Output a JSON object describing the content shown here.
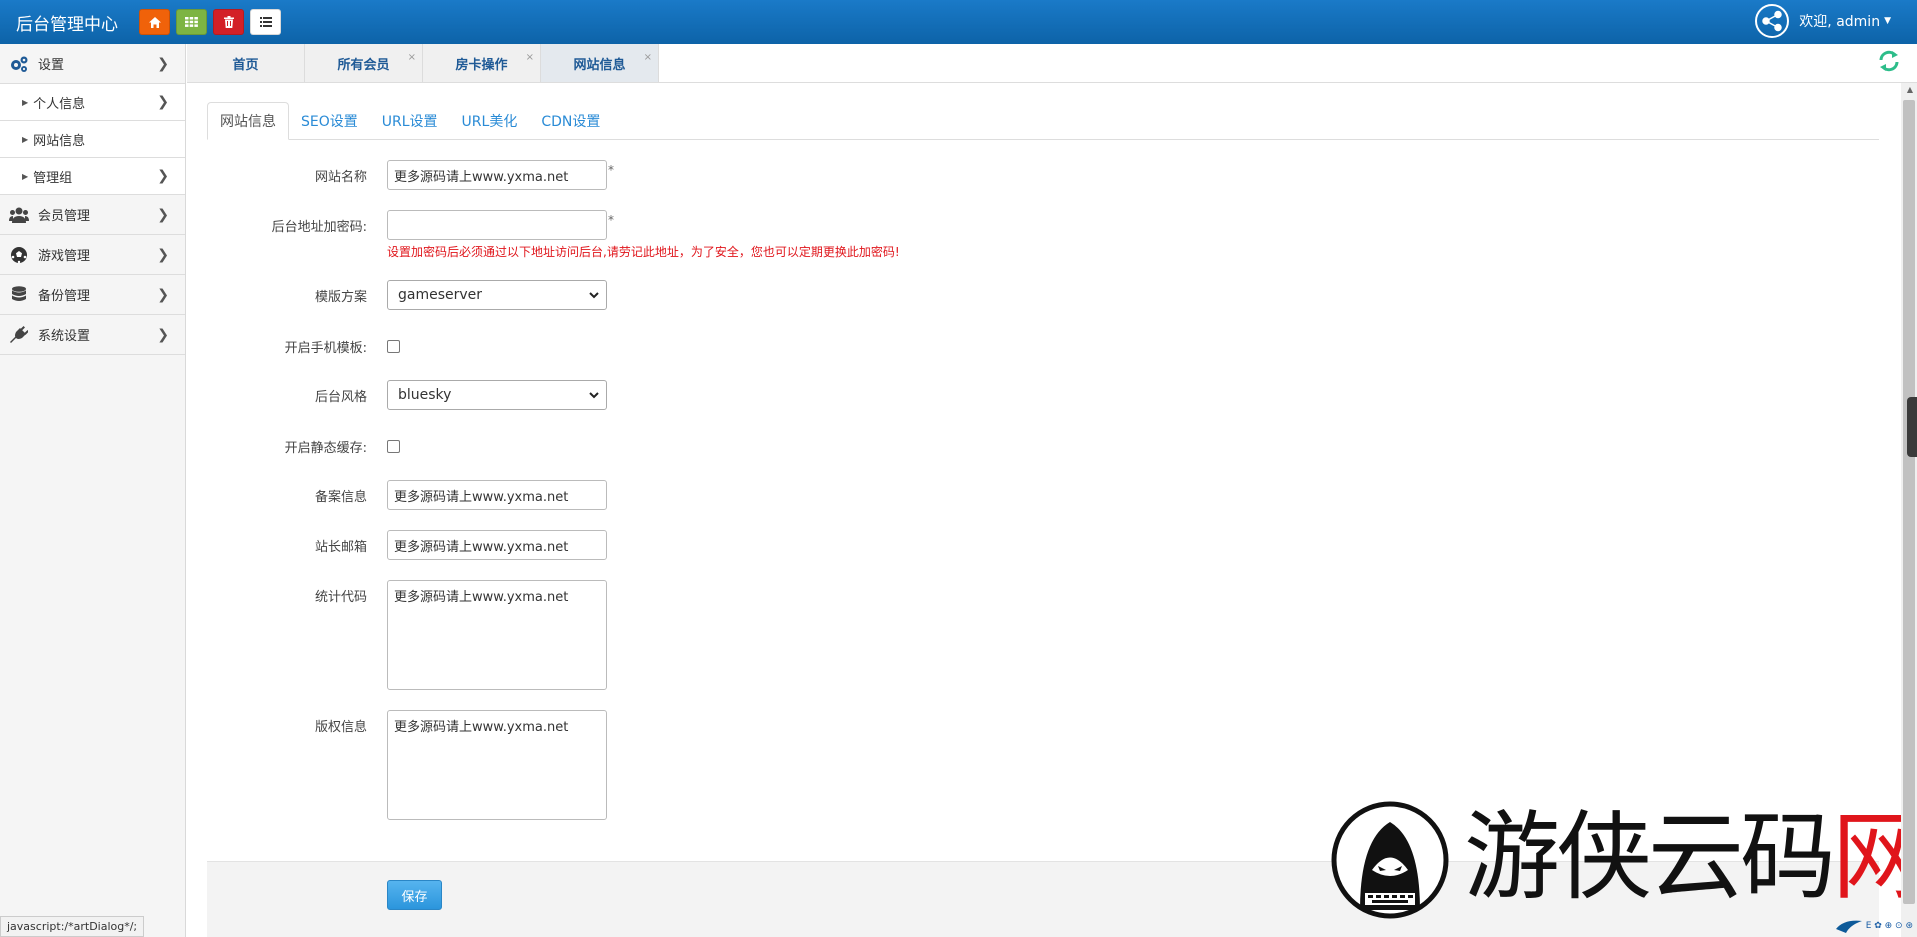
{
  "header": {
    "brand": "后台管理中心",
    "quick_buttons": [
      {
        "name": "home",
        "icon": "home-icon",
        "color": "#f0620a"
      },
      {
        "name": "grid",
        "icon": "grid-icon",
        "color": "#7db443"
      },
      {
        "name": "trash",
        "icon": "trash-icon",
        "color": "#d32027"
      },
      {
        "name": "list",
        "icon": "list-icon",
        "color": "#ffffff"
      }
    ],
    "welcome": "欢迎, admin",
    "bg_color": "#1a7ac8"
  },
  "sidebar": {
    "items": [
      {
        "label": "设置",
        "icon": "gears-icon"
      },
      {
        "label": "个人信息"
      },
      {
        "label": "网站信息"
      },
      {
        "label": "管理组"
      },
      {
        "label": "会员管理",
        "icon": "users-icon"
      },
      {
        "label": "游戏管理",
        "icon": "soccer-ball-icon"
      },
      {
        "label": "备份管理",
        "icon": "database-icon"
      },
      {
        "label": "系统设置",
        "icon": "plug-icon"
      }
    ]
  },
  "tabs": [
    {
      "label": "首页"
    },
    {
      "label": "所有会员",
      "closable": true
    },
    {
      "label": "房卡操作",
      "closable": true
    },
    {
      "label": "网站信息",
      "closable": true,
      "active": true
    }
  ],
  "tab_close_glyph": "×",
  "subtabs": [
    {
      "label": "网站信息",
      "active": true
    },
    {
      "label": "SEO设置"
    },
    {
      "label": "URL设置"
    },
    {
      "label": "URL美化"
    },
    {
      "label": "CDN设置"
    }
  ],
  "form": {
    "site_name": {
      "label": "网站名称",
      "value": "更多源码请上www.yxma.net",
      "required_mark": "*"
    },
    "admin_path_pwd": {
      "label": "后台地址加密码:",
      "value": "",
      "required_mark": "*",
      "warning": "设置加密码后必须通过以下地址访问后台,请劳记此地址，为了安全，您也可以定期更换此加密码!"
    },
    "template": {
      "label": "模版方案",
      "value": "gameserver"
    },
    "mobile_template": {
      "label": "开启手机模板:",
      "checked": false
    },
    "admin_style": {
      "label": "后台风格",
      "value": "bluesky"
    },
    "static_cache": {
      "label": "开启静态缓存:",
      "checked": false
    },
    "icp": {
      "label": "备案信息",
      "value": "更多源码请上www.yxma.net"
    },
    "email": {
      "label": "站长邮箱",
      "value": "更多源码请上www.yxma.net"
    },
    "stats_code": {
      "label": "统计代码",
      "value": "更多源码请上www.yxma.net"
    },
    "copyright": {
      "label": "版权信息",
      "value": "更多源码请上www.yxma.net"
    },
    "save_label": "保存"
  },
  "status_bar": "javascript:/*artDialog*/;",
  "watermark": {
    "text": "游侠云码网",
    "highlight": "网",
    "highlight_color": "#e0151b"
  },
  "tray_text": "E ✿ ⊕ ⊙ ⊛"
}
